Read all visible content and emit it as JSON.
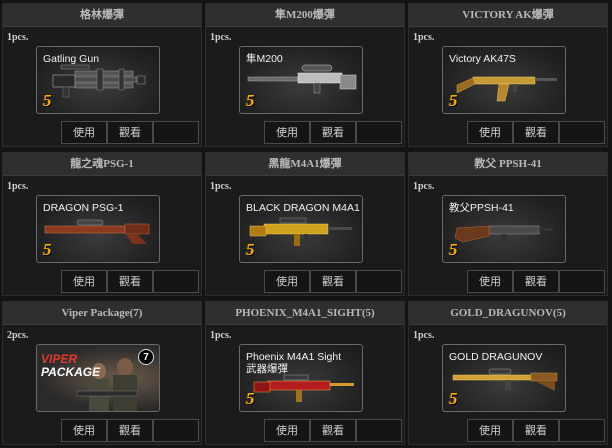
{
  "items": [
    {
      "title": "格林爆彈",
      "count": "1pcs.",
      "name": "Gatling Gun",
      "grade": "5",
      "use": "使用",
      "view": "觀看",
      "icon": "gatling-gun-icon"
    },
    {
      "title": "隼M200爆彈",
      "count": "1pcs.",
      "name": "隼M200",
      "grade": "5",
      "use": "使用",
      "view": "觀看",
      "icon": "sniper-rifle-icon"
    },
    {
      "title": "VICTORY AK爆彈",
      "count": "1pcs.",
      "name": "Victory AK47S",
      "grade": "5",
      "use": "使用",
      "view": "觀看",
      "icon": "ak47-rifle-icon"
    },
    {
      "title": "龍之魂PSG-1",
      "count": "1pcs.",
      "name": "DRAGON PSG-1",
      "grade": "5",
      "use": "使用",
      "view": "觀看",
      "icon": "psg1-rifle-icon"
    },
    {
      "title": "黑龍M4A1爆彈",
      "count": "1pcs.",
      "name": "BLACK DRAGON M4A1",
      "grade": "5",
      "use": "使用",
      "view": "觀看",
      "icon": "m4a1-rifle-icon"
    },
    {
      "title": "教父 PPSH-41",
      "count": "1pcs.",
      "name": "教父PPSH-41",
      "grade": "5",
      "use": "使用",
      "view": "觀看",
      "icon": "ppsh-smg-icon"
    },
    {
      "title": "Viper Package(7)",
      "count": "2pcs.",
      "name": "",
      "grade": "",
      "use": "使用",
      "view": "觀看",
      "icon": "soldiers-package-icon",
      "package": {
        "line1": "VIPER",
        "line2": "PACKAGE",
        "badge": "7"
      }
    },
    {
      "title": "PHOENIX_M4A1_SIGHT(5)",
      "count": "1pcs.",
      "name": "Phoenix  M4A1 Sight\n武器爆彈",
      "grade": "5",
      "use": "使用",
      "view": "觀看",
      "icon": "phoenix-m4a1-icon"
    },
    {
      "title": "GOLD_DRAGUNOV(5)",
      "count": "1pcs.",
      "name": "GOLD DRAGUNOV",
      "grade": "5",
      "use": "使用",
      "view": "觀看",
      "icon": "dragunov-rifle-icon"
    }
  ]
}
